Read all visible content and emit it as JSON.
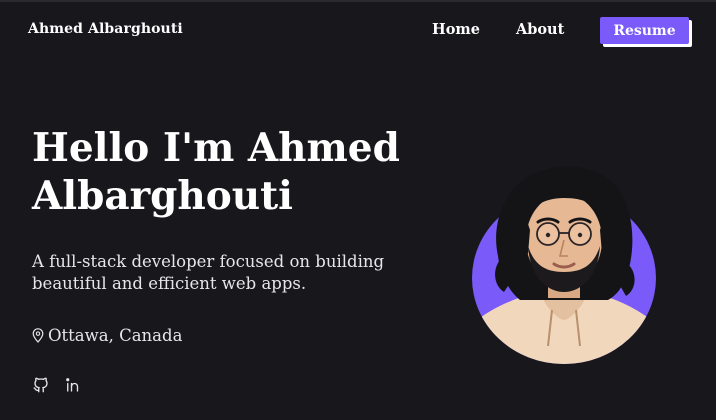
{
  "nav": {
    "brand": "Ahmed Albarghouti",
    "links": [
      {
        "label": "Home"
      },
      {
        "label": "About"
      }
    ],
    "resume_label": "Resume"
  },
  "hero": {
    "title": "Hello I'm Ahmed Albarghouti",
    "tagline": "A full-stack developer focused on building beautiful and efficient web apps.",
    "location": "Ottawa, Canada",
    "socials": [
      {
        "icon": "github-icon"
      },
      {
        "icon": "linkedin-icon"
      }
    ]
  },
  "colors": {
    "background": "#18171c",
    "accent": "#7a5af8",
    "text": "#ffffff"
  }
}
